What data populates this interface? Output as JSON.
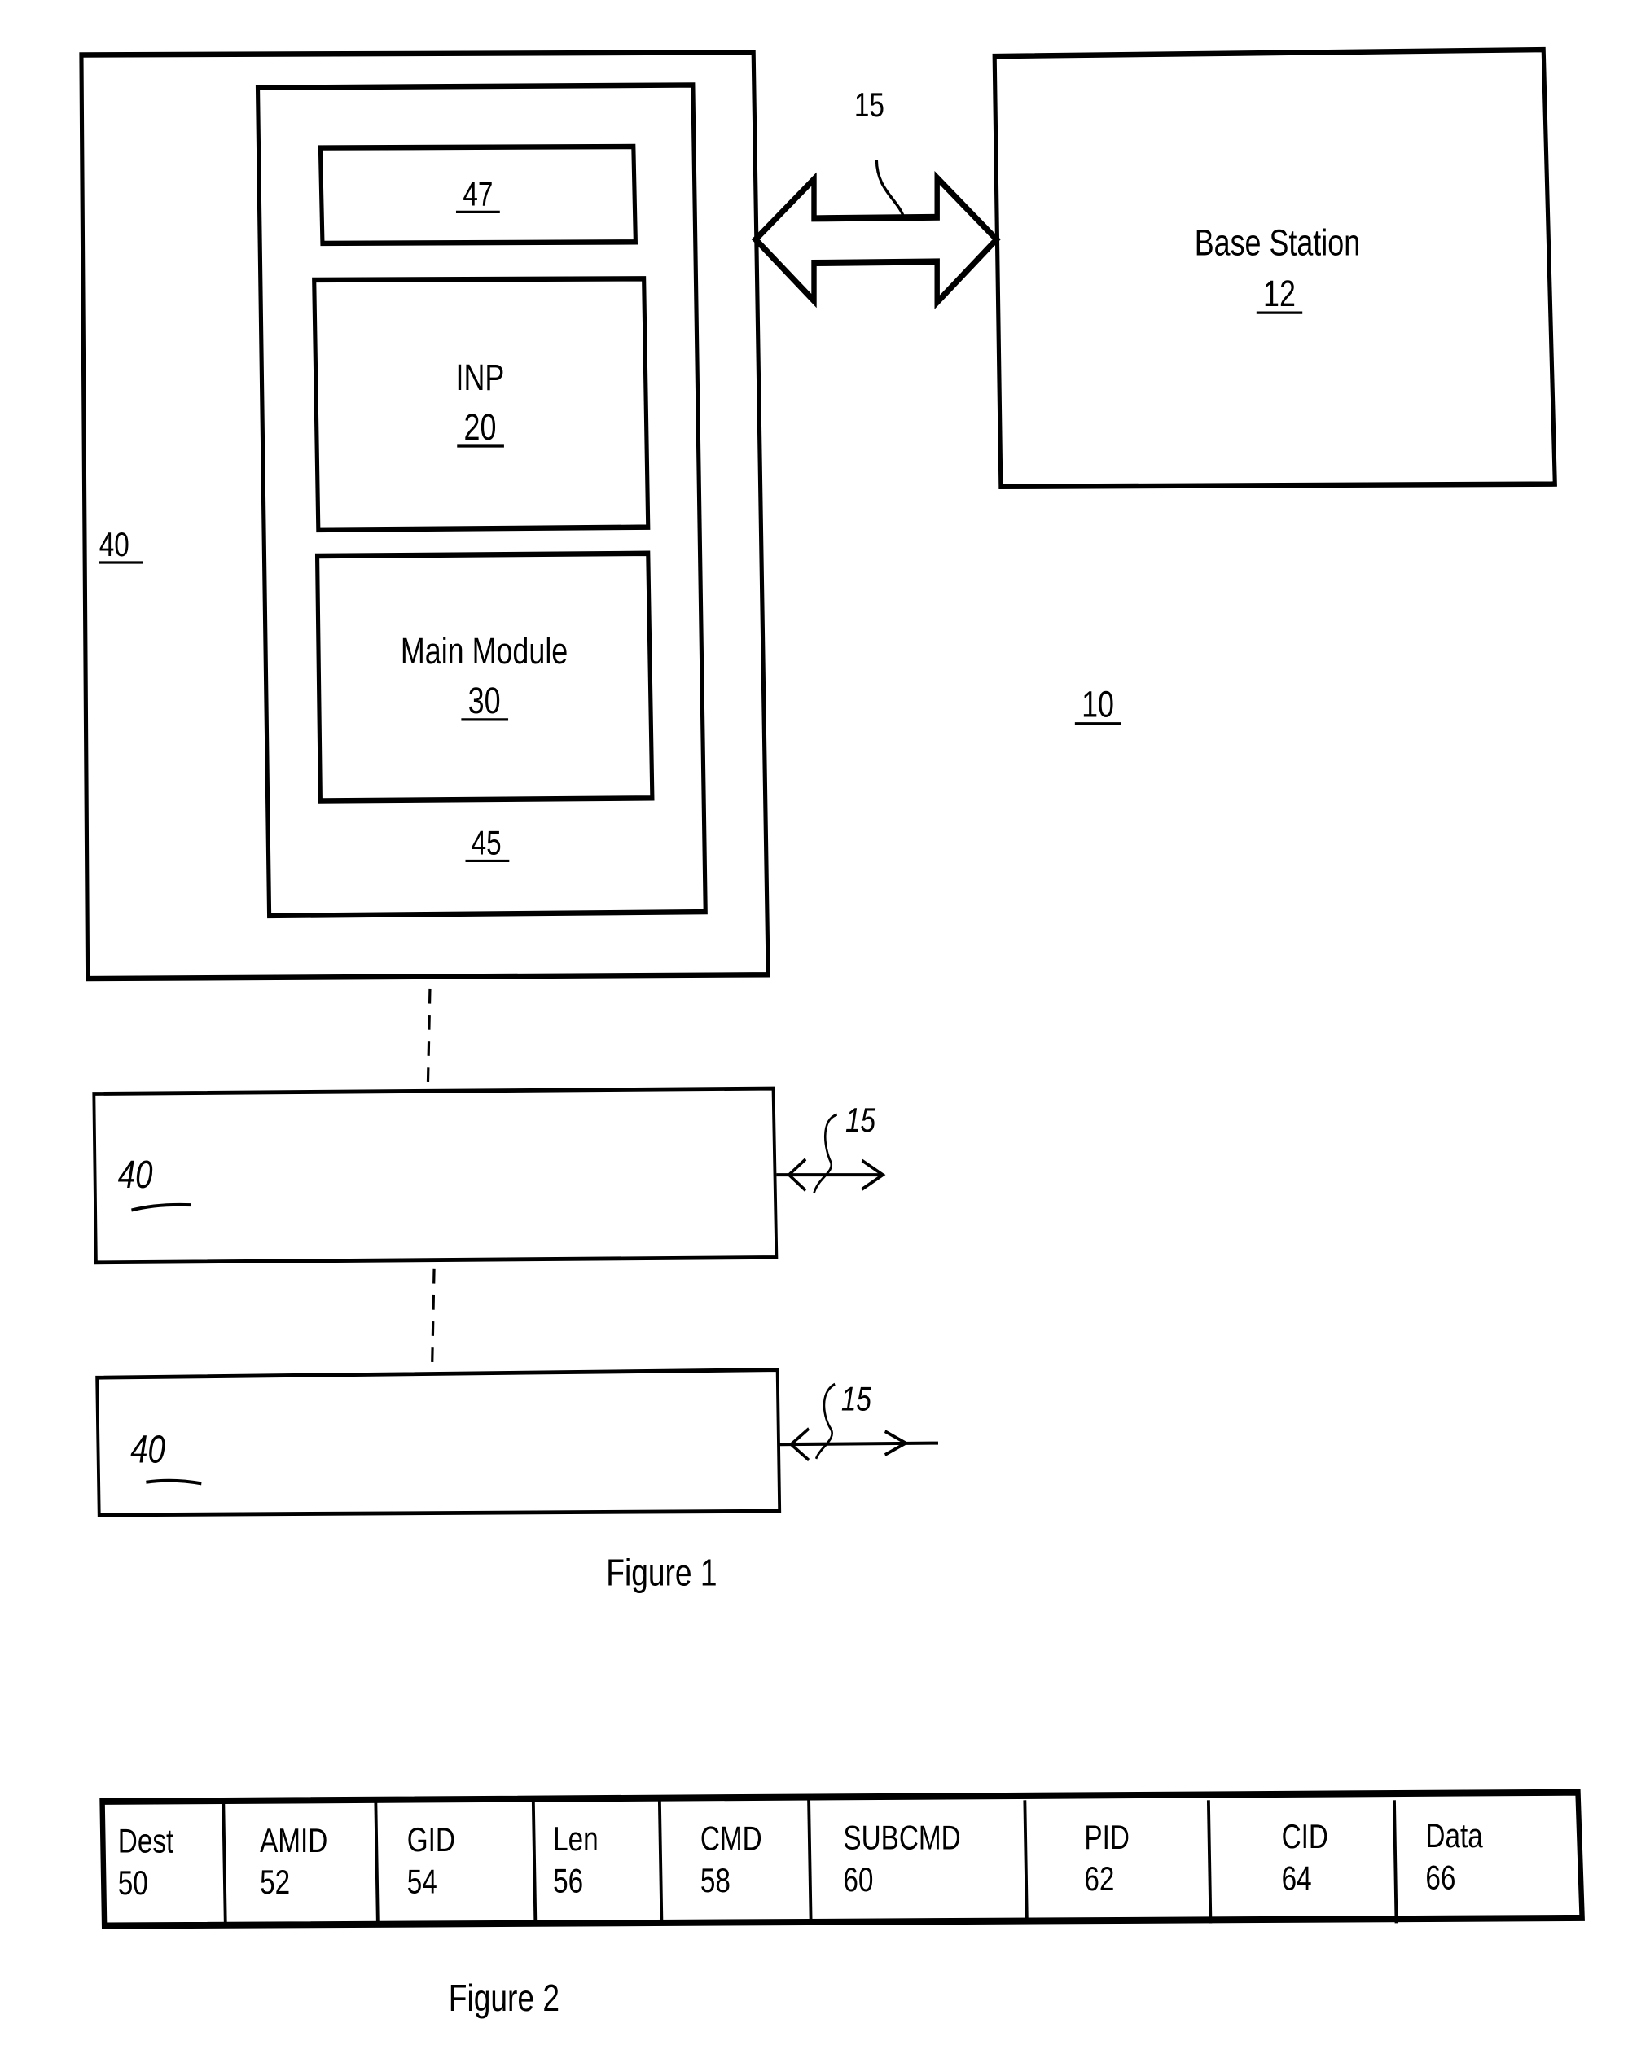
{
  "figure1": {
    "caption": "Figure 1",
    "system_label": "10",
    "node_outer_label": "40",
    "node_board_label": "45",
    "block_47": {
      "ref": "47"
    },
    "inp": {
      "title": "INP",
      "ref": "20"
    },
    "main_module": {
      "title": "Main Module",
      "ref": "30"
    },
    "base_station": {
      "title": "Base Station",
      "ref": "12"
    },
    "link_label": "15",
    "additional_nodes": [
      {
        "label": "40",
        "link_label": "15"
      },
      {
        "label": "40",
        "link_label": "15"
      }
    ]
  },
  "figure2": {
    "caption": "Figure 2",
    "fields": [
      {
        "name": "Dest",
        "ref": "50"
      },
      {
        "name": "AMID",
        "ref": "52"
      },
      {
        "name": "GID",
        "ref": "54"
      },
      {
        "name": "Len",
        "ref": "56"
      },
      {
        "name": "CMD",
        "ref": "58"
      },
      {
        "name": "SUBCMD",
        "ref": "60"
      },
      {
        "name": "PID",
        "ref": "62"
      },
      {
        "name": "CID",
        "ref": "64"
      },
      {
        "name": "Data",
        "ref": "66"
      }
    ]
  }
}
